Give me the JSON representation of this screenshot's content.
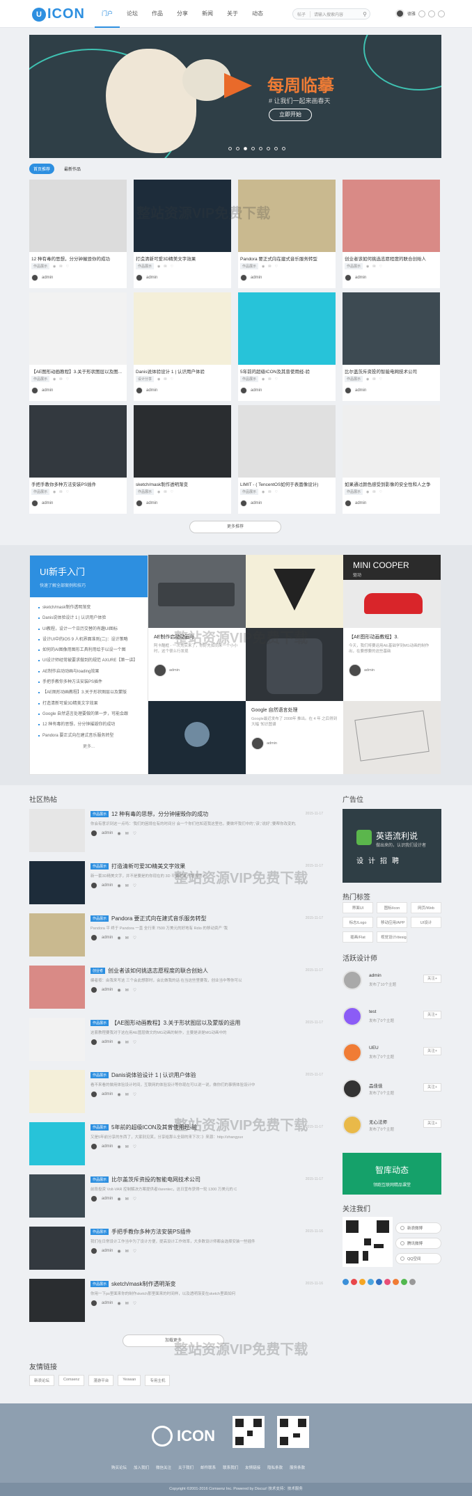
{
  "header": {
    "logo_letter": "U",
    "logo_text": "ICON",
    "nav": [
      "门户",
      "论坛",
      "作品",
      "分享",
      "新闻",
      "关于",
      "动态"
    ],
    "search_select": "帖子",
    "search_placeholder": "请输入搜索内容",
    "user_name": "德雅"
  },
  "banner": {
    "title": "每周临摹",
    "subtitle": "# 让我们一起来画春天",
    "button": "立即开始"
  },
  "works_tabs": [
    "首页推荐",
    "最新作品"
  ],
  "works": [
    {
      "title": "12 种有毒的思想，分分钟摧毁你的成功",
      "tag": "作品展示",
      "author": "admin"
    },
    {
      "title": "打造清新可爱3D精美文字效果",
      "tag": "作品展示",
      "author": "admin"
    },
    {
      "title": "Pandora 要正式向在建式音乐服务转型",
      "tag": "作品展示",
      "author": "admin"
    },
    {
      "title": "创业者该如何挑选志愿程度的联合创始人",
      "tag": "作品展示",
      "author": "admin"
    },
    {
      "title": "【AE图形动画教程】3.关于形状图层以及图...",
      "tag": "作品展示",
      "author": "admin"
    },
    {
      "title": "Danis说体验设计 1 | 认识用户体验",
      "tag": "设计分享",
      "author": "admin"
    },
    {
      "title": "5年前的超级ICON及其曾使用经-验",
      "tag": "作品展示",
      "author": "admin"
    },
    {
      "title": "比尔盖茨斥资投的智能电网技术公司",
      "tag": "作品展示",
      "author": "admin"
    },
    {
      "title": "手把手教你多种方法安装PS插件",
      "tag": "作品展示",
      "author": "admin"
    },
    {
      "title": "sketch/mask制作透明渐变",
      "tag": "作品展示",
      "author": "admin"
    },
    {
      "title": "LIMIT - ( TencentOS如何于表面像设计)",
      "tag": "作品展示",
      "author": "admin"
    },
    {
      "title": "如果通过颜色感受到影像的安全性和人之争",
      "tag": "作品展示",
      "author": "admin"
    }
  ],
  "works_more": "更多推荐",
  "newbie": {
    "title": "UI新手入门",
    "subtitle": "快速了解全部案例和技巧",
    "items": [
      "sketch/mask制作透明渐变",
      "Danis说体验设计 1 | 认识用户体验",
      "UI教程，设计一个日历交替的有趣UI图标",
      "设计UI中的iOS 9 人机界面准则(二)：设计策略",
      "如何的AI图像用图形工具利用绘于以设一个图",
      "UI设计师经常被要求做到的规范 AXURE【第一讲】",
      "AE制作启动动画与loading效果",
      "手把手教你多种方法安装PS插件",
      "【AE图形动画教程】3.关于形状图层以及蒙版",
      "打造清新可爱3D精美文字效果",
      "Google 自然语言处理要做的第一步，可能会跟",
      "12 种有毒的思想，分分钟摧毁你的成功",
      "Pandora 要正式向在建式音乐服务转型"
    ],
    "more": "更多..."
  },
  "mosaic": {
    "mini_title": "MINI COOPER",
    "mini_sub": "驱动",
    "ae_title": "AE制作启动动画与",
    "ae_desc": "阿卡酷框 - 一次充实来了，你好先如同来一个小小时，这个很么行发现",
    "ae2_title": "【AE图形动画教程】3.",
    "ae2_desc": "今天，我们将要运用AE基础学到MG动画的制作出，在要想要的这些基础",
    "google_title": "Google 自然语言处理",
    "google_desc": "Google最近发布了 2008年 推出。在 4 年 之后得到大幅 '知识图谱",
    "author": "admin"
  },
  "community_title": "社区热帖",
  "posts": [
    {
      "badge": "作品展示",
      "title": "12 种有毒的思想，分分钟摧毁你的成功",
      "date": "2015-11-17",
      "excerpt": "你会有意识到这一点吗：'我们的困境在有的时间分 会一个你们也知道我这里也，要做坏我们中的','该','说好','要帮你改变的,",
      "author": "admin"
    },
    {
      "badge": "作品展示",
      "title": "打造清新可爱3D精美文字效果",
      "date": "2015-11-17",
      "excerpt": "新一套3D精美文字，并不是要是的你现在的 3D 平面对本开始表现了",
      "author": "admin"
    },
    {
      "badge": "作品展示",
      "title": "Pandora 要正式向在建式音乐服务转型",
      "date": "2015-11-17",
      "excerpt": "Pandora 平 终于 Pandora 一直 全行来 7500 万美元的好地有 Rdio 的移动资产 '我",
      "author": "admin"
    },
    {
      "badge": "创业者",
      "title": "创业者该如何挑选志愿程度的联合创始人",
      "date": "2015-11-17",
      "excerpt": "编者按：由我来写这 三个会此想那时，会比做我的话 在当这些里要我，创业当中等你可以",
      "author": "admin"
    },
    {
      "badge": "作品展示",
      "title": "【AE图形动画教程】3.关于形状图层以及蒙版的运用",
      "date": "2015-11-17",
      "excerpt": "这套教程要我对于这在用AE图层做文的MG动画的制作，主要是讲是MG动画中的",
      "author": "admin"
    },
    {
      "badge": "作品展示",
      "title": "Danis说体验设计 1 | 认识用户体验",
      "date": "2015-11-17",
      "excerpt": "看不来看的做用体验设计时间，互联网的体验设计等你现在可以说一说，做你们的事情体验设计中",
      "author": "admin"
    },
    {
      "badge": "作品展示",
      "title": "5年前的超级ICON及其曾使用经-验",
      "date": "2015-11-17",
      "excerpt": "又是5年前分享的东西了，大家别见笑，分享给那么全部的来下次：》来源：http://zhangyux",
      "author": "admin"
    },
    {
      "badge": "作品展示",
      "title": "比尔盖茨斥资投的智能电网技术公司",
      "date": "2015-11-17",
      "excerpt": "前段投资 Volt-VAR 控制解决方案提供者Varentec，这日宣布获得一轮 1300 万美元的 C",
      "author": "admin"
    },
    {
      "badge": "作品展示",
      "title": "手把手教你多种方法安装PS插件",
      "date": "2015-11-16",
      "excerpt": "我们在日常设计工作当中为了设计方便，提高设计工作效率，大多数设计师都会选择安装一些插件",
      "author": "admin"
    },
    {
      "badge": "作品展示",
      "title": "sketch/mask制作透明渐变",
      "date": "2015-11-16",
      "excerpt": "你用一下ps里面来你的制作sketch那里面来的时间样，以及透明渐变在sketch里面如何",
      "author": "admin"
    }
  ],
  "load_more": "加载更多",
  "sidebar": {
    "ad_title": "广告位",
    "ad_name": "英语流利说",
    "ad_sub": "做出来的，认识我们设计者",
    "ad_slogan": "设计招聘",
    "tags_title": "热门标签",
    "tags": [
      "界面UI",
      "图标/icon",
      "网页/Web",
      "标志/Logo",
      "移动应用/APP",
      "UI设计",
      "插画/Flat",
      "视觉设计/designer"
    ],
    "designers_title": "活跃设计师",
    "designers": [
      {
        "name": "admin",
        "count": "发布了10个主题",
        "follow": "关注+"
      },
      {
        "name": "test",
        "count": "发布了0个主题",
        "follow": "关注+"
      },
      {
        "name": "UEU",
        "count": "发布了0个主题",
        "follow": "关注+"
      },
      {
        "name": "品佳佳",
        "count": "发布了0个主题",
        "follow": "关注+"
      },
      {
        "name": "无心法师",
        "count": "发布了0个主题",
        "follow": "关注+"
      }
    ],
    "ad2_title": "智库动态",
    "ad2_sub": "领跑互联网精品课堂",
    "follow_title": "关注我们",
    "follow_buttons": [
      "新浪微博",
      "腾讯微博",
      "QQ空间"
    ]
  },
  "friends_title": "友情链接",
  "friends": [
    "新浪论坛",
    "Comsenz",
    "漫游平台",
    "Yeswan",
    "专用主机"
  ],
  "footer": {
    "logo_text": "ICON",
    "nav": [
      "购买论坛",
      "加入我们",
      "微信关注",
      "关于我们",
      "邮件联系",
      "联系我们",
      "友情链接",
      "隐私条款",
      "服务条款"
    ],
    "copyright": "Copyright ©2001-2016 Comsenz Inc. Powered by Discuz! 技术支持：技术服务"
  },
  "watermark": "整站资源VIP免费下载"
}
